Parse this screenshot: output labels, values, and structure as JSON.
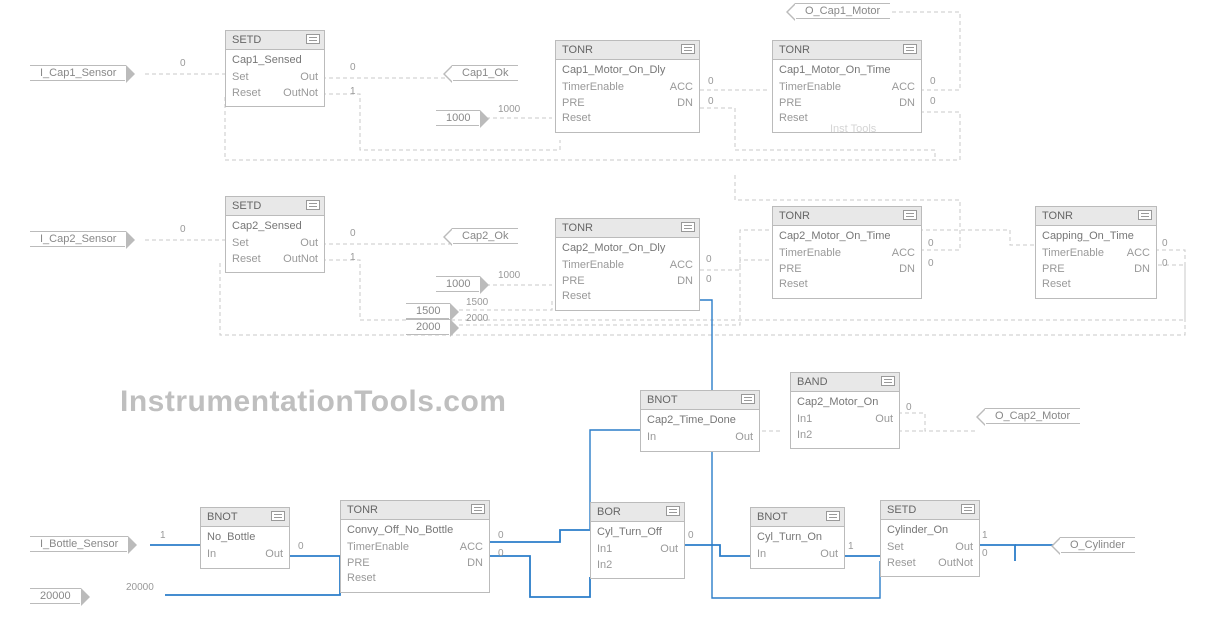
{
  "watermark": {
    "main": "InstrumentationTools.com",
    "small": "Inst Tools"
  },
  "inputs": {
    "cap1_sensor": "I_Cap1_Sensor",
    "cap2_sensor": "I_Cap2_Sensor",
    "bottle_sensor": "I_Bottle_Sensor",
    "const_1000a": "1000",
    "const_1000b": "1000",
    "const_1500": "1500",
    "const_2000": "2000",
    "const_20000": "20000"
  },
  "outputs": {
    "cap1_motor": "O_Cap1_Motor",
    "cap2_motor": "O_Cap2_Motor",
    "cylinder": "O_Cylinder",
    "cap1_ok": "Cap1_Ok",
    "cap2_ok": "Cap2_Ok"
  },
  "wirelabels": {
    "zero": "0",
    "one": "1",
    "v1000": "1000",
    "v1500": "1500",
    "v2000": "2000",
    "v20000": "20000"
  },
  "blocks": {
    "setd1": {
      "type": "SETD",
      "title": "Cap1_Sensed",
      "pins": {
        "a": "Set",
        "b": "Reset",
        "c": "Out",
        "d": "OutNot"
      }
    },
    "setd2": {
      "type": "SETD",
      "title": "Cap2_Sensed",
      "pins": {
        "a": "Set",
        "b": "Reset",
        "c": "Out",
        "d": "OutNot"
      }
    },
    "setd3": {
      "type": "SETD",
      "title": "Cylinder_On",
      "pins": {
        "a": "Set",
        "b": "Reset",
        "c": "Out",
        "d": "OutNot"
      }
    },
    "tonr1": {
      "type": "TONR",
      "title": "Cap1_Motor_On_Dly",
      "pins": {
        "a": "TimerEnable",
        "b": "PRE",
        "c": "Reset",
        "d": "ACC",
        "e": "DN"
      }
    },
    "tonr2": {
      "type": "TONR",
      "title": "Cap1_Motor_On_Time",
      "pins": {
        "a": "TimerEnable",
        "b": "PRE",
        "c": "Reset",
        "d": "ACC",
        "e": "DN"
      }
    },
    "tonr3": {
      "type": "TONR",
      "title": "Cap2_Motor_On_Dly",
      "pins": {
        "a": "TimerEnable",
        "b": "PRE",
        "c": "Reset",
        "d": "ACC",
        "e": "DN"
      }
    },
    "tonr4": {
      "type": "TONR",
      "title": "Cap2_Motor_On_Time",
      "pins": {
        "a": "TimerEnable",
        "b": "PRE",
        "c": "Reset",
        "d": "ACC",
        "e": "DN"
      }
    },
    "tonr5": {
      "type": "TONR",
      "title": "Capping_On_Time",
      "pins": {
        "a": "TimerEnable",
        "b": "PRE",
        "c": "Reset",
        "d": "ACC",
        "e": "DN"
      }
    },
    "tonr6": {
      "type": "TONR",
      "title": "Convy_Off_No_Bottle",
      "pins": {
        "a": "TimerEnable",
        "b": "PRE",
        "c": "Reset",
        "d": "ACC",
        "e": "DN"
      }
    },
    "bnot1": {
      "type": "BNOT",
      "title": "Cap2_Time_Done",
      "pins": {
        "a": "In",
        "b": "Out"
      }
    },
    "bnot2": {
      "type": "BNOT",
      "title": "No_Bottle",
      "pins": {
        "a": "In",
        "b": "Out"
      }
    },
    "bnot3": {
      "type": "BNOT",
      "title": "Cyl_Turn_On",
      "pins": {
        "a": "In",
        "b": "Out"
      }
    },
    "band1": {
      "type": "BAND",
      "title": "Cap2_Motor_On",
      "pins": {
        "a": "In1",
        "b": "In2",
        "c": "Out"
      }
    },
    "bor1": {
      "type": "BOR",
      "title": "Cyl_Turn_Off",
      "pins": {
        "a": "In1",
        "b": "In2",
        "c": "Out"
      }
    }
  }
}
